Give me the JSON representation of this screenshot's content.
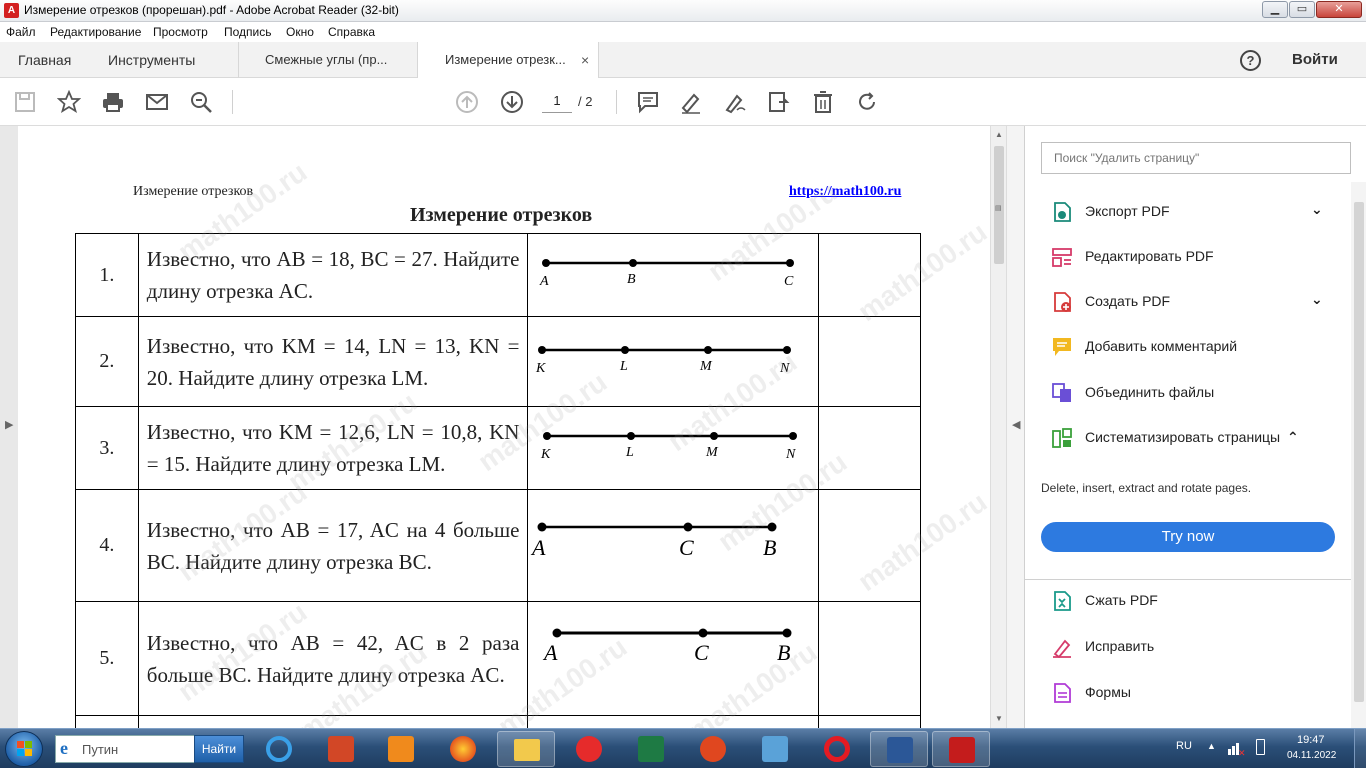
{
  "window": {
    "title": "Измерение отрезков (прорешан).pdf - Adobe Acrobat Reader (32-bit)"
  },
  "menu": [
    "Файл",
    "Редактирование",
    "Просмотр",
    "Подпись",
    "Окно",
    "Справка"
  ],
  "tabs": {
    "home": "Главная",
    "tools": "Инструменты",
    "doc1": "Смежные углы (пр...",
    "doc2": "Измерение отрезк...",
    "close_glyph": "×",
    "help_glyph": "?",
    "signin": "Войти"
  },
  "toolbar": {
    "page_current": "1",
    "page_total": "/ 2"
  },
  "document": {
    "header_left": "Измерение отрезков",
    "header_link": "https://math100.ru",
    "title": "Измерение отрезков",
    "watermark": "math100.ru",
    "rows": [
      {
        "num": "1.",
        "text": "Известно, что AB = 18, BC = 27. Найдите длину отрезка AC.",
        "labels": [
          "A",
          "B",
          "C"
        ]
      },
      {
        "num": "2.",
        "text": "Известно, что KM = 14, LN = 13, KN = 20. Найдите длину отрезка LM.",
        "labels": [
          "K",
          "L",
          "M",
          "N"
        ]
      },
      {
        "num": "3.",
        "text": "Известно, что KM = 12,6, LN = 10,8, KN = 15. Найдите длину отрезка LM.",
        "labels": [
          "K",
          "L",
          "M",
          "N"
        ]
      },
      {
        "num": "4.",
        "text": "Известно, что AB = 17, AC на 4 больше BC. Найдите длину отрезка BC.",
        "labels": [
          "A",
          "C",
          "B"
        ]
      },
      {
        "num": "5.",
        "text": "Известно, что AB = 42, AC в 2 раза больше BC. Найдите длину отрезка AC.",
        "labels": [
          "A",
          "C",
          "B"
        ]
      }
    ]
  },
  "panel": {
    "search_placeholder": "Поиск \"Удалить страницу\"",
    "items": [
      {
        "label": "Экспорт PDF",
        "icon": "export-pdf-icon",
        "chevron": "⌄"
      },
      {
        "label": "Редактировать PDF",
        "icon": "edit-pdf-icon"
      },
      {
        "label": "Создать PDF",
        "icon": "create-pdf-icon",
        "chevron": "⌄"
      },
      {
        "label": "Добавить комментарий",
        "icon": "comment-icon"
      },
      {
        "label": "Объединить файлы",
        "icon": "combine-files-icon"
      },
      {
        "label": "Систематизировать страницы",
        "icon": "organize-pages-icon",
        "chevron": "⌃"
      }
    ],
    "description": "Delete, insert, extract and rotate pages.",
    "try_button": "Try now",
    "items2": [
      {
        "label": "Сжать PDF",
        "icon": "compress-pdf-icon"
      },
      {
        "label": "Исправить",
        "icon": "fix-icon"
      },
      {
        "label": "Формы",
        "icon": "forms-icon"
      }
    ]
  },
  "taskbar": {
    "search_value": "Путин",
    "search_button": "Найти",
    "lang": "RU",
    "time": "19:47",
    "date": "04.11.2022"
  },
  "colors": {
    "accent": "#2d7ae0",
    "pdf_red": "#d32020"
  }
}
